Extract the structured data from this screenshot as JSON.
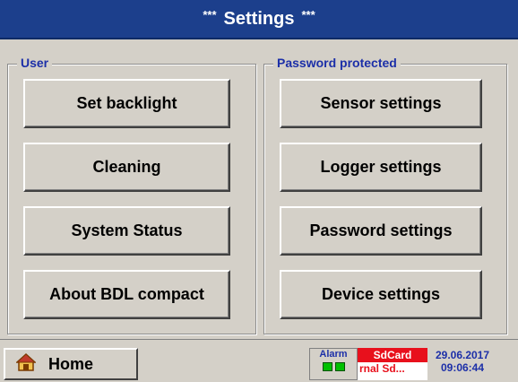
{
  "header": {
    "title": "Settings",
    "decor_left": "***",
    "decor_right": "***"
  },
  "user_group": {
    "legend": "User",
    "buttons": [
      "Set backlight",
      "Cleaning",
      "System Status",
      "About BDL compact"
    ]
  },
  "password_group": {
    "legend": "Password protected",
    "buttons": [
      "Sensor settings",
      "Logger settings",
      "Password settings",
      "Device settings"
    ]
  },
  "bottom": {
    "home_label": "Home",
    "home_icon": "house-icon",
    "alarm_label": "Alarm",
    "sdcard_label": "SdCard",
    "sdcard_status": "rnal Sd...",
    "date": "29.06.2017",
    "time": "09:06:44"
  },
  "colors": {
    "title_bg": "#1c3f8c",
    "legend_text": "#1c2fa8",
    "sdcard_bg": "#e8101c",
    "led_green": "#00c000"
  }
}
